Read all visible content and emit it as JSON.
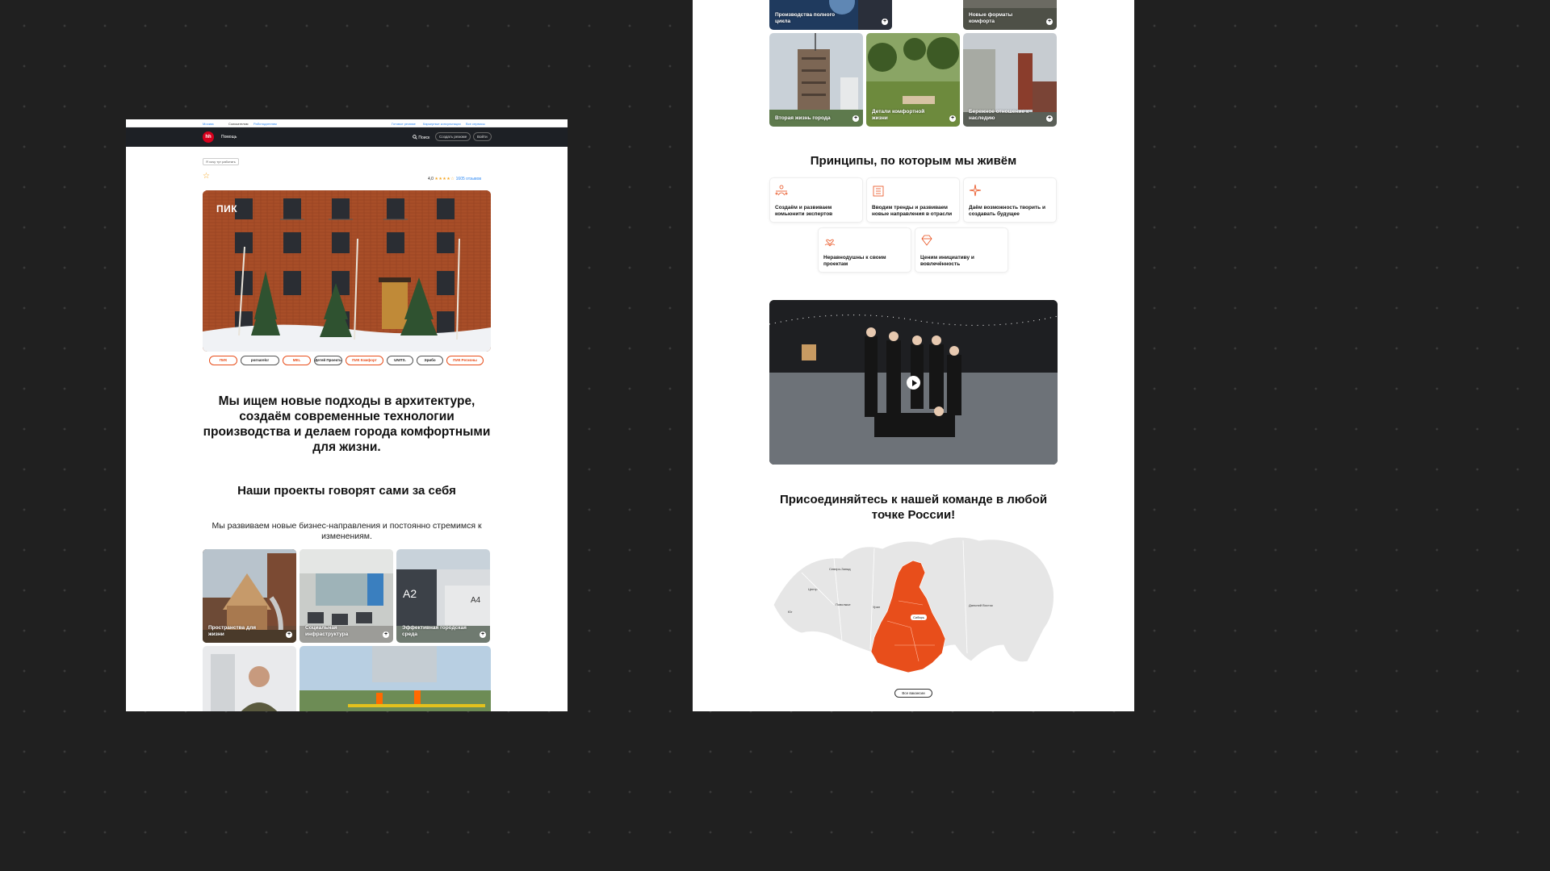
{
  "topbar": {
    "city": "Москва",
    "job_seekers": "Соискателям",
    "employers": "Работодателям",
    "ready_resume": "Готовое резюме",
    "career_services": "Карьерные консультации",
    "all_services": "Все сервисы"
  },
  "navbar": {
    "logo": "hh",
    "help": "Помощь",
    "search": "Поиск",
    "create_resume": "Создать резюме",
    "login": "Войти"
  },
  "company": {
    "tag": "Я хочу тут работать",
    "rating_value": "4,0",
    "rating_stars": 4,
    "reviews": "1605 отзывов",
    "hero_logo": "ПИК"
  },
  "brands": [
    {
      "name": "ПИК",
      "red": true
    },
    {
      "name": "pornarelcr",
      "red": false
    },
    {
      "name": "MEL",
      "red": true
    },
    {
      "name": "Детей Проекты",
      "red": false
    },
    {
      "name": "ПИК Комфорт",
      "red": true
    },
    {
      "name": "UNITS.",
      "red": false
    },
    {
      "name": "Эрибо",
      "red": false
    },
    {
      "name": "ПИК Регионы",
      "red": true
    }
  ],
  "mission": "Мы ищем новые подходы в архитектуре, создаём современные технологии производства и делаем города комфортными для жизни.",
  "projects": {
    "title": "Наши проекты говорят сами за себя",
    "subtitle": "Мы развиваем новые бизнес-направления и постоянно стремимся к изменениям.",
    "cards": [
      {
        "label": "Пространства для жизни"
      },
      {
        "label": "Социальная инфраструктура"
      },
      {
        "label": "Эффективная городская среда"
      },
      {
        "label": "Производства полного цикла"
      },
      {
        "label": "Новые форматы комфорта"
      },
      {
        "label": "Вторая жизнь города"
      },
      {
        "label": "Детали комфортной жизни"
      },
      {
        "label": "Бережное отношение к наследию"
      }
    ]
  },
  "principles": {
    "title": "Принципы, по которым мы живём",
    "items": [
      {
        "text": "Создаём и развиваем комьюнити экспертов",
        "icon": "people-network-icon"
      },
      {
        "text": "Вводим тренды и развиваем новые направления в отрасли",
        "icon": "building-icon"
      },
      {
        "text": "Даём возможность творить и создавать будущее",
        "icon": "sparkle-icon"
      },
      {
        "text": "Неравнодушны к своим проектам",
        "icon": "hands-heart-icon"
      },
      {
        "text": "Ценим инициативу и вовлечённость",
        "icon": "diamond-icon"
      }
    ]
  },
  "join": {
    "title": "Присоединяйтесь к нашей команде в любой точке России!",
    "regions": [
      "Северо-Запад",
      "Центр",
      "Поволжье",
      "Урал",
      "Юг",
      "Сибирь",
      "Дальний Восток"
    ],
    "active_region": "Сибирь",
    "all_vacancies": "Все вакансии"
  },
  "colors": {
    "accent": "#e84e1b",
    "hh_red": "#d6001c",
    "nav_bg": "#1d2025",
    "link": "#2f8af5",
    "star": "#f5a623"
  }
}
